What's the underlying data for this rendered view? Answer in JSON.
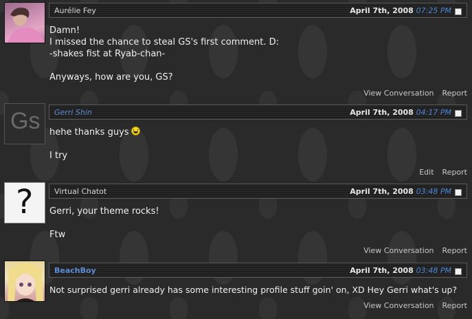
{
  "comments": [
    {
      "author": "Aurélie Fey",
      "date": "April 7th, 2008",
      "time": "07:25 PM",
      "body": "Damn!\nI missed the chance to steal GS's first comment. D:\n-shakes fist at Ryab-chan-\n\nAnyways, how are you, GS?",
      "actions": [
        "View Conversation",
        "Report"
      ]
    },
    {
      "author": "Gerri Shin",
      "avatar_text": "Gs",
      "date": "April 7th, 2008",
      "time": "04:17 PM",
      "body_line1": "hehe thanks guys",
      "body_rest": "\n\nI try",
      "actions": [
        "Edit",
        "Report"
      ]
    },
    {
      "author": "Virtual Chatot",
      "avatar_text": "?",
      "date": "April 7th, 2008",
      "time": "03:48 PM",
      "body": "Gerri, your theme rocks!\n\nFtw",
      "actions": [
        "View Conversation",
        "Report"
      ]
    },
    {
      "author": "BeachBoy",
      "date": "April 7th, 2008",
      "time": "03:48 PM",
      "body": "Not surprised gerri already has some interesting profile stuff goin' on, XD Hey Gerri what's up?",
      "actions": [
        "View Conversation",
        "Report"
      ]
    }
  ],
  "colors": {
    "link": "#5b8ed6",
    "time": "#4d86d6",
    "background": "#2a2a2a"
  }
}
